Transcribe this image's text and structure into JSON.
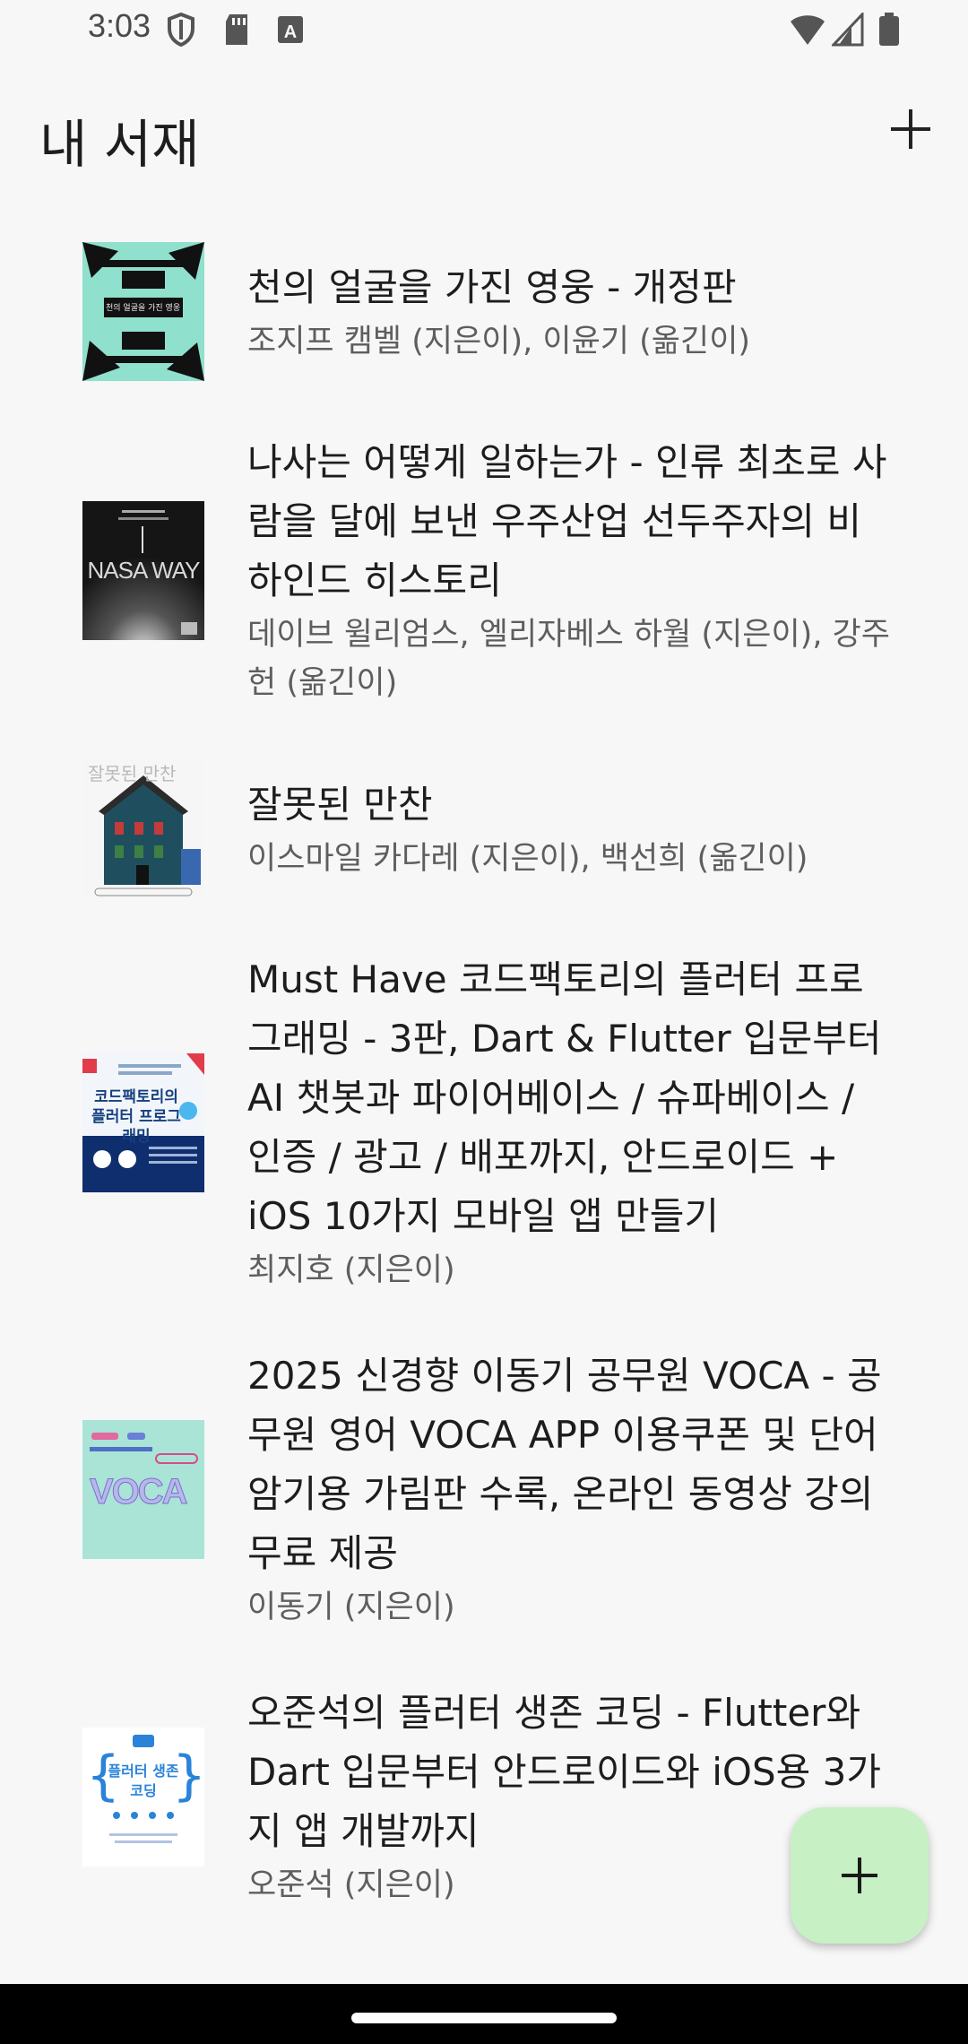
{
  "status_bar": {
    "time": "3:03",
    "icons_left": [
      "shield-icon",
      "sd-card-icon",
      "text-a-icon"
    ],
    "icons_right": [
      "wifi-icon",
      "cell-signal-icon",
      "battery-icon"
    ]
  },
  "app_bar": {
    "title": "내 서재",
    "add_icon": "plus-icon"
  },
  "books": [
    {
      "title": "천의 얼굴을 가진 영웅 - 개정판",
      "author": "조지프 캠벨 (지은이), 이윤기 (옮긴이)",
      "cover_title": "천의 얼굴을 가진 영웅"
    },
    {
      "title": "나사는 어떻게 일하는가 - 인류 최초로 사람을 달에 보낸 우주산업 선두주자의 비하인드 히스토리",
      "author": "데이브 윌리엄스, 엘리자베스 하월 (지은이), 강주헌 (옮긴이)",
      "cover_title": "NASA WAY"
    },
    {
      "title": "잘못된 만찬",
      "author": "이스마일 카다레 (지은이), 백선희 (옮긴이)",
      "cover_title": "잘못된 만찬"
    },
    {
      "title": "Must Have 코드팩토리의 플러터 프로그래밍 - 3판, Dart & Flutter 입문부터 AI 챗봇과 파이어베이스 / 슈파베이스 / 인증 / 광고 / 배포까지, 안드로이드 + iOS 10가지 모바일 앱 만들기",
      "author": "최지호 (지은이)",
      "cover_title": "코드팩토리의 플러터 프로그래밍"
    },
    {
      "title": "2025 신경향 이동기 공무원 VOCA - 공무원 영어 VOCA APP 이용쿠폰 및 단어 암기용 가림판 수록, 온라인 동영상 강의 무료 제공",
      "author": "이동기 (지은이)",
      "cover_title": "VOCA"
    },
    {
      "title": "오준석의 플러터 생존 코딩 - Flutter와 Dart 입문부터 안드로이드와 iOS용 3가지 앱 개발까지",
      "author": "오준석 (지은이)",
      "cover_title": "플러터 생존코딩"
    }
  ],
  "fab": {
    "icon": "plus-icon"
  },
  "colors": {
    "background": "#f7f7f7",
    "fab": "#c7f0c5",
    "title_text": "#1d1d1d",
    "author_text": "#5e5e5e"
  }
}
